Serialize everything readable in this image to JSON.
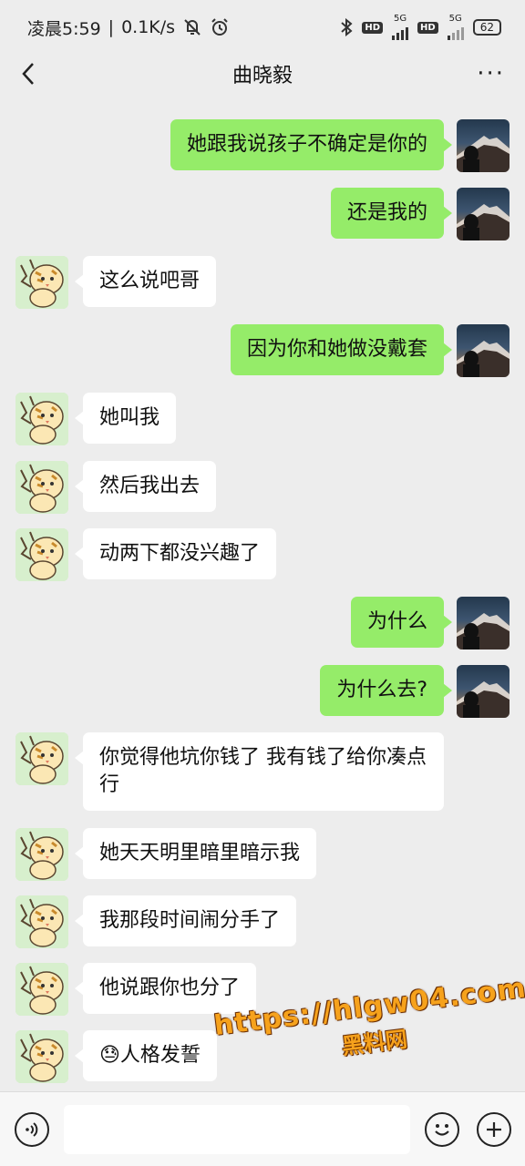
{
  "status": {
    "time": "凌晨5:59",
    "speed": "0.1K/s",
    "network_labels": [
      "5G",
      "5G"
    ],
    "hd_label": "HD",
    "battery": "62"
  },
  "header": {
    "title": "曲晓毅",
    "back_icon": "back-arrow-icon",
    "more_icon": "more-dots-icon"
  },
  "messages": [
    {
      "sender": "me",
      "text": "她跟我说孩子不确定是你的"
    },
    {
      "sender": "me",
      "text": "还是我的"
    },
    {
      "sender": "other",
      "text": "这么说吧哥"
    },
    {
      "sender": "me",
      "text": "因为你和她做没戴套"
    },
    {
      "sender": "other",
      "text": "她叫我"
    },
    {
      "sender": "other",
      "text": "然后我出去"
    },
    {
      "sender": "other",
      "text": "动两下都没兴趣了"
    },
    {
      "sender": "me",
      "text": "为什么"
    },
    {
      "sender": "me",
      "text": "为什么去?"
    },
    {
      "sender": "other",
      "text": "你觉得他坑你钱了 我有钱了给你凑点行"
    },
    {
      "sender": "other",
      "text": "她天天明里暗里暗示我"
    },
    {
      "sender": "other",
      "text": "我那段时间闹分手了"
    },
    {
      "sender": "other",
      "text": "他说跟你也分了"
    },
    {
      "sender": "other",
      "text": "😓人格发誓"
    }
  ],
  "watermark": {
    "url": "https://hlgw04.com",
    "name": "黑料网"
  },
  "input_bar": {
    "voice_icon": "voice-icon",
    "emoji_icon": "emoji-icon",
    "plus_icon": "plus-icon",
    "input_value": ""
  },
  "colors": {
    "background": "#ededed",
    "my_bubble": "#95ec69",
    "other_bubble": "#ffffff",
    "watermark": "#f6a21c"
  }
}
